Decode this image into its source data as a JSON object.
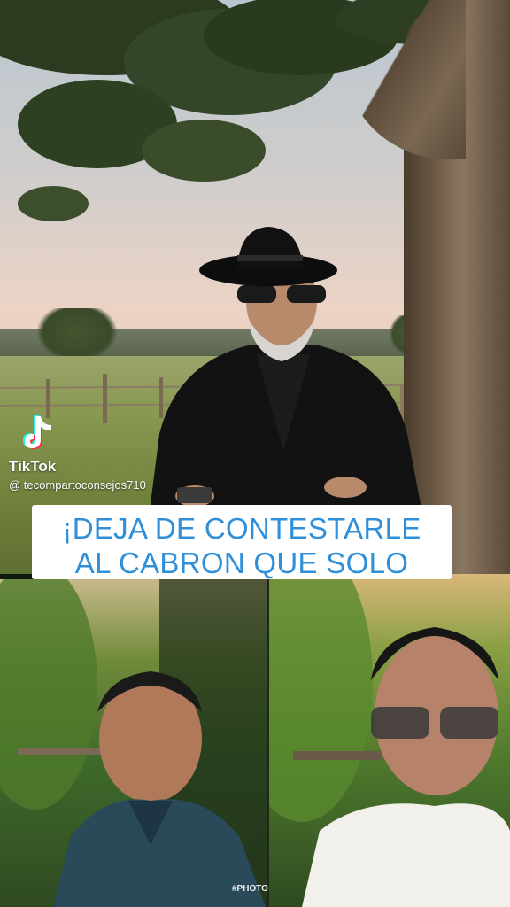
{
  "video": {
    "tiktok_label": "TikTok",
    "handle": "@ tecompartoconsejos710",
    "caption": {
      "line1": "¡DEJA DE CONTESTARLE",
      "line2": "AL CABRON QUE SOLO"
    },
    "watermark": "#PHOTO"
  },
  "colors": {
    "caption_text": "#2f8fd8",
    "caption_bg": "#ffffff",
    "tiktok_cyan": "#25f4ee",
    "tiktok_red": "#fe2c55"
  },
  "icons": {
    "tiktok": "tiktok-icon"
  }
}
